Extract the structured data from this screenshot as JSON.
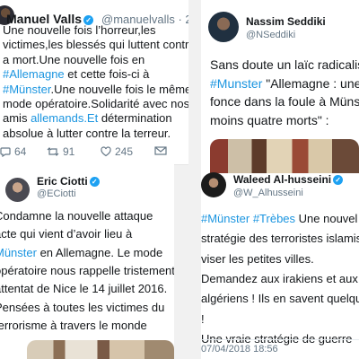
{
  "tweets": {
    "valls": {
      "name": "Manuel Valls",
      "handle": "@manuelvalls",
      "time": "· 2h",
      "lines": [
        [
          {
            "t": "Une nouvelle fois l’horreur,les"
          }
        ],
        [
          {
            "t": "victimes,les blessés qui luttent contre"
          }
        ],
        [
          {
            "t": "a mort.Une nouvelle fois en"
          }
        ],
        [
          {
            "t": "#Allemagne",
            "link": true
          },
          {
            "t": " et cette fois-ci à"
          }
        ],
        [
          {
            "t": "#Münster",
            "link": true
          },
          {
            "t": ".Une nouvelle fois le même"
          }
        ],
        [
          {
            "t": "mode opératoire.Solidarité avec nos"
          }
        ],
        [
          {
            "t": "amis "
          },
          {
            "t": "allemands.Et",
            "link": true
          },
          {
            "t": " détermination"
          }
        ],
        [
          {
            "t": "absolue à lutter contre la terreur."
          }
        ]
      ],
      "replies": "64",
      "retweets": "91",
      "likes": "245"
    },
    "ciotti": {
      "name": "Eric Ciotti",
      "handle": "@ECiotti",
      "lines": [
        [
          {
            "t": "Condamne la nouvelle attaque"
          }
        ],
        [
          {
            "t": "acte qui vient d’avoir lieu à"
          }
        ],
        [
          {
            "t": "Münster",
            "link": true
          },
          {
            "t": " en Allemagne. Le mode"
          }
        ],
        [
          {
            "t": "opératoire nous rappelle tristement"
          }
        ],
        [
          {
            "t": "attentat de Nice le 14 juillet 2016."
          }
        ],
        [
          {
            "t": "Pensées à toutes les victimes du"
          }
        ],
        [
          {
            "t": "terrorisme à travers le monde"
          }
        ]
      ]
    },
    "seddiki": {
      "name": "Nassim Seddiki",
      "handle": "@NSeddiki",
      "lines": [
        [
          {
            "t": "Sans doute un laïc radicalisé."
          }
        ],
        [
          {
            "t": "#Munster",
            "link": true
          },
          {
            "t": " \"Allemagne : une v"
          }
        ],
        [
          {
            "t": "fonce dans la foule à Münste"
          }
        ],
        [
          {
            "t": "moins quatre morts\" :"
          }
        ]
      ]
    },
    "waleed": {
      "name": "Waleed Al-husseini",
      "handle": "@W_Alhusseini",
      "lines": [
        [
          {
            "t": "#Münster",
            "link": true
          },
          {
            "t": " "
          },
          {
            "t": "#Trèbes",
            "link": true
          },
          {
            "t": " Une nouvel"
          }
        ],
        [
          {
            "t": "stratégie des terroristes islamis"
          }
        ],
        [
          {
            "t": "viser les petites villes."
          }
        ],
        [
          {
            "t": "Demandez aux irakiens et aux"
          }
        ],
        [
          {
            "t": "algériens ! Ils en savent quelqu"
          }
        ],
        [
          {
            "t": "!"
          }
        ],
        [
          {
            "t": "Une vraie stratégie de guerre"
          }
        ]
      ],
      "timestamp": "07/04/2018 18:56"
    }
  },
  "colors": {
    "link": "#1b95e0",
    "verified": "#1da1f2",
    "muted": "#657786"
  }
}
